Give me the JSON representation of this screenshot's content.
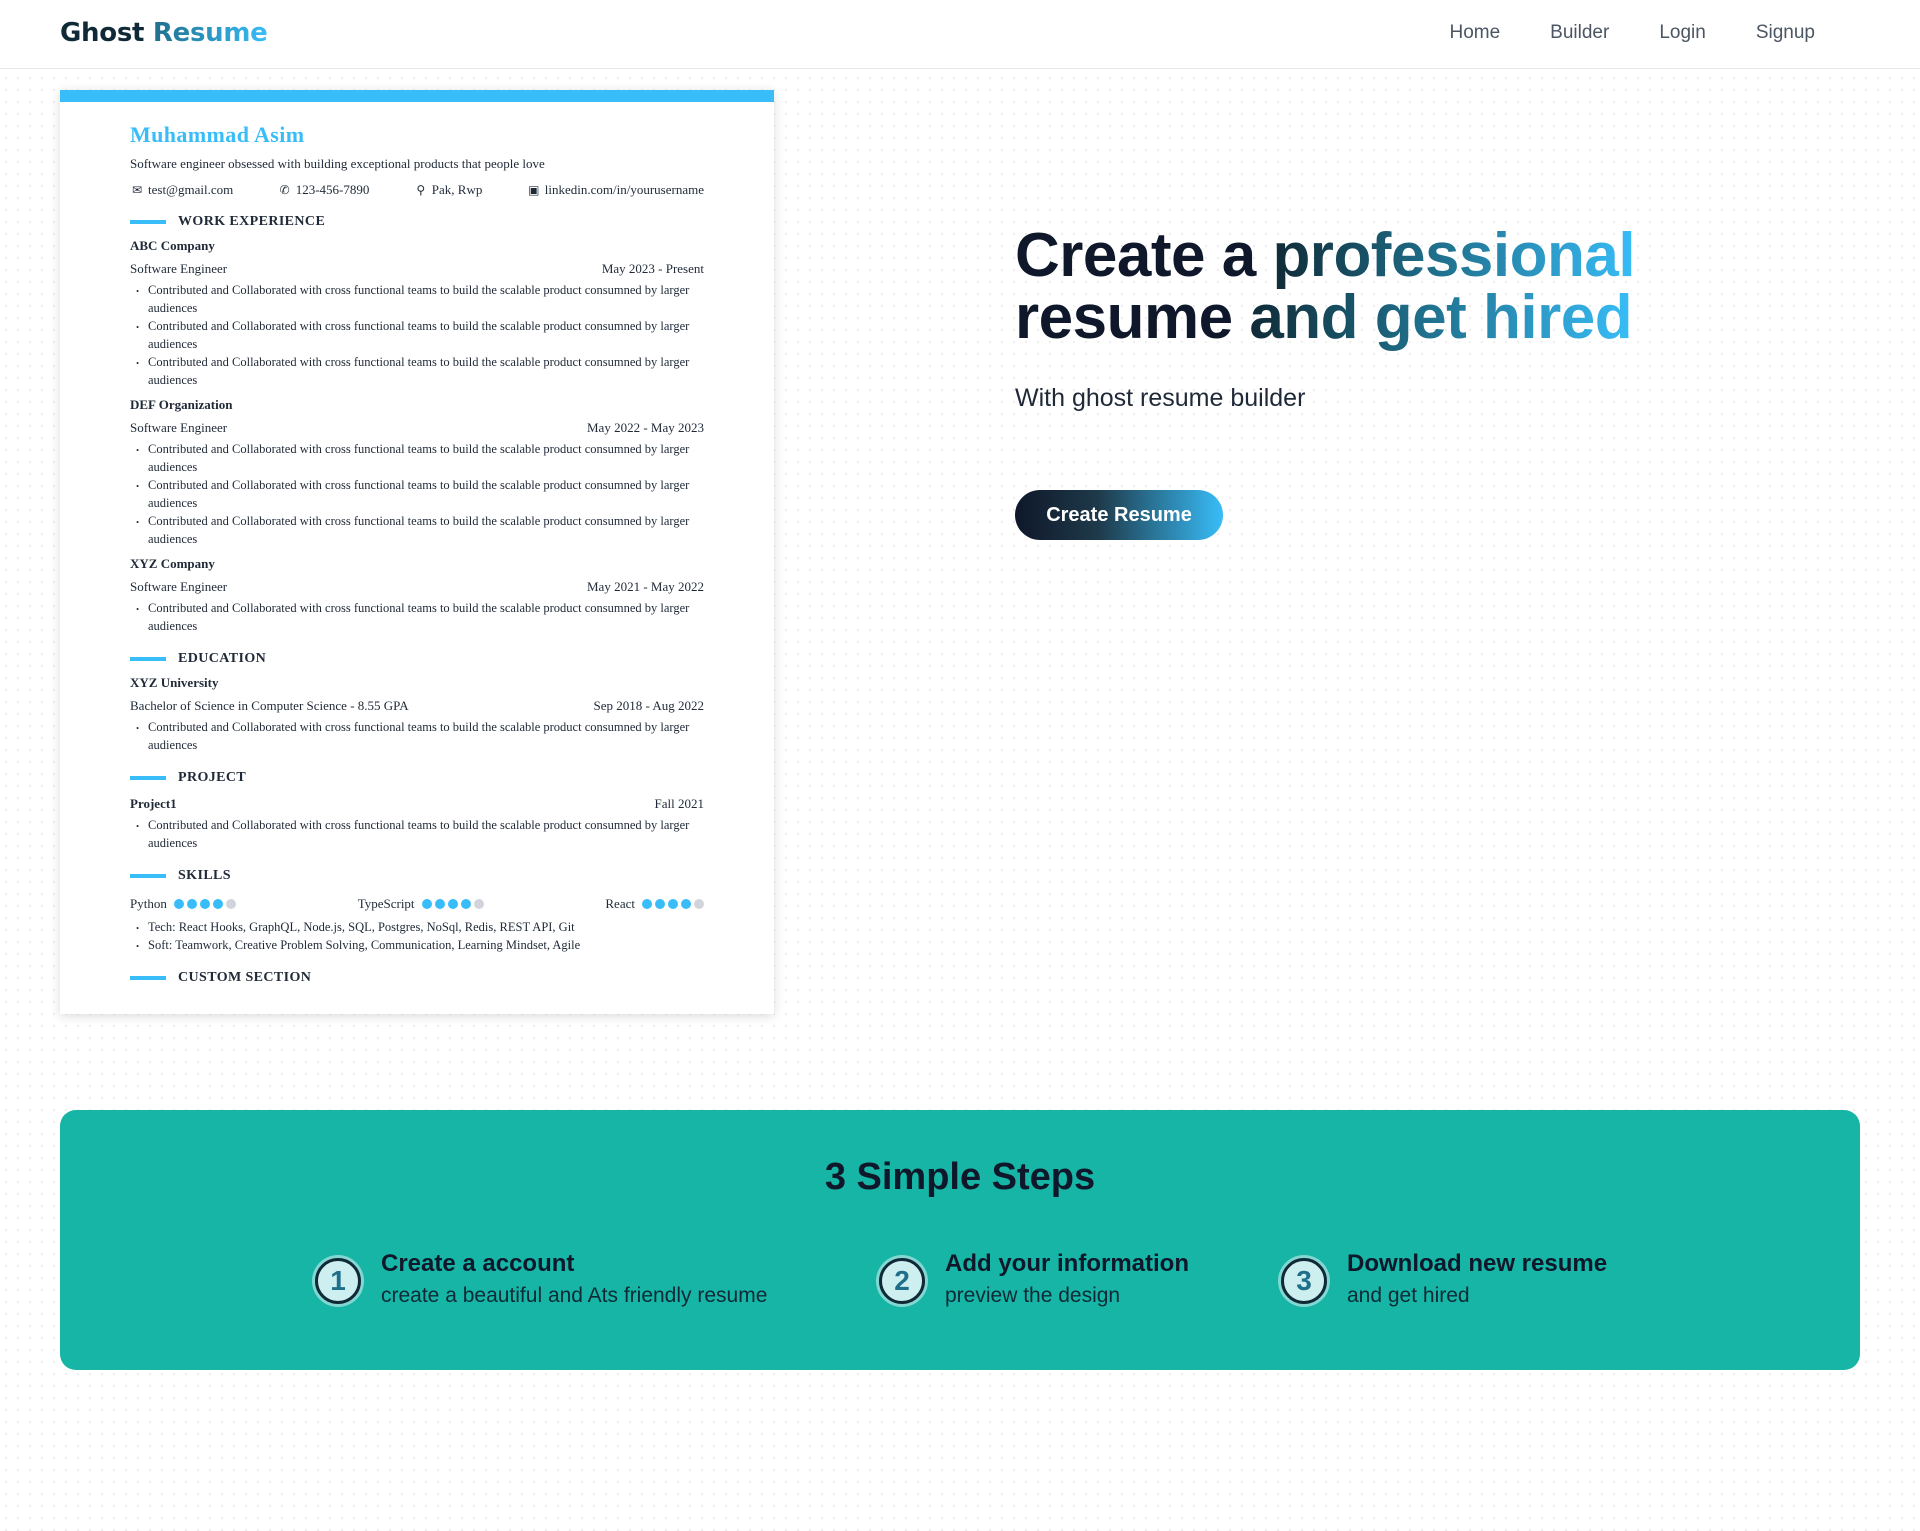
{
  "nav": {
    "logo_first": "Ghost",
    "logo_second": "Resume",
    "links": [
      "Home",
      "Builder",
      "Login",
      "Signup"
    ]
  },
  "resume": {
    "name": "Muhammad Asim",
    "summary": "Software engineer obsessed with building exceptional products that people love",
    "contacts": {
      "email": "test@gmail.com",
      "phone": "123-456-7890",
      "location": "Pak, Rwp",
      "linkedin": "linkedin.com/in/yourusername"
    },
    "sections": {
      "work": "WORK EXPERIENCE",
      "education": "EDUCATION",
      "project": "PROJECT",
      "skills": "SKILLS",
      "custom": "CUSTOM SECTION"
    },
    "bullet_text": "Contributed and Collaborated with cross functional teams to build the scalable product consumned by larger audiences",
    "work": [
      {
        "company": "ABC Company",
        "role": "Software Engineer",
        "dates": "May 2023 - Present"
      },
      {
        "company": "DEF Organization",
        "role": "Software Engineer",
        "dates": "May 2022 - May 2023"
      },
      {
        "company": "XYZ Company",
        "role": "Software Engineer",
        "dates": "May 2021 - May 2022"
      }
    ],
    "education": {
      "school": "XYZ University",
      "degree": "Bachelor of Science in Computer Science - 8.55 GPA",
      "dates": "Sep 2018 - Aug 2022"
    },
    "project": {
      "name": "Project1",
      "date": "Fall 2021"
    },
    "skills": [
      {
        "name": "Python",
        "level": 4,
        "max": 5
      },
      {
        "name": "TypeScript",
        "level": 4,
        "max": 5
      },
      {
        "name": "React",
        "level": 4,
        "max": 5
      }
    ],
    "tech": "Tech: React Hooks, GraphQL, Node.js, SQL, Postgres, NoSql, Redis, REST API, Git",
    "soft": "Soft: Teamwork, Creative Problem Solving, Communication, Learning Mindset, Agile"
  },
  "hero": {
    "title_a": "Create a ",
    "title_b": "professional",
    "title_c": "resume ",
    "title_d": "and get hired",
    "subtitle": "With ghost resume builder",
    "cta": "Create Resume"
  },
  "steps": {
    "title": "3 Simple Steps",
    "items": [
      {
        "num": "1",
        "title": "Create a account",
        "desc": "create a beautiful and Ats friendly resume"
      },
      {
        "num": "2",
        "title": "Add your information",
        "desc": "preview the design"
      },
      {
        "num": "3",
        "title": "Download new resume",
        "desc": "and get hired"
      }
    ]
  },
  "colors": {
    "accent": "#38bdf8",
    "teal": "#16b5a5",
    "dark": "#0f2a36"
  }
}
